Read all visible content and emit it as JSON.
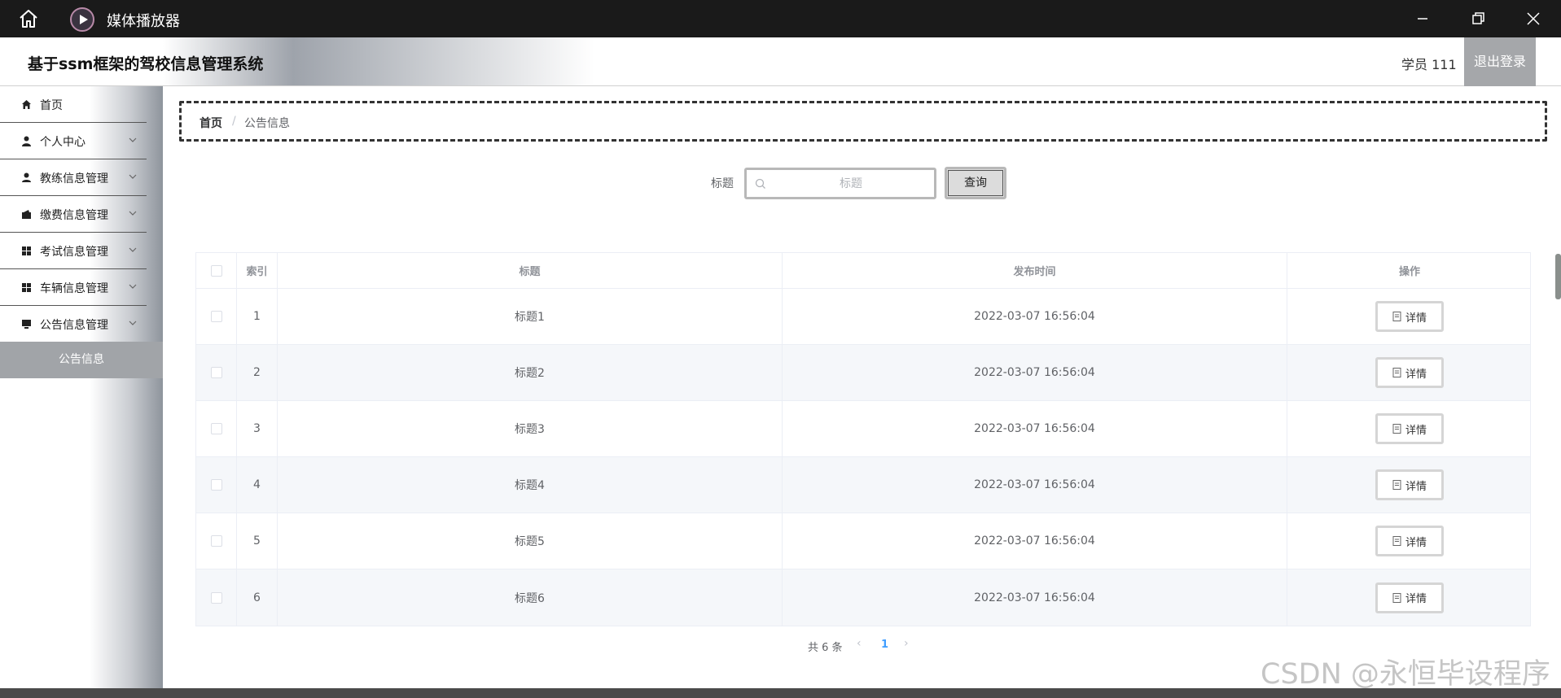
{
  "window": {
    "title": "媒体播放器",
    "icons": [
      "home-icon",
      "play-icon",
      "minimize-icon",
      "restore-icon",
      "close-icon"
    ]
  },
  "header": {
    "system_title": "基于ssm框架的驾校信息管理系统",
    "user_label": "学员 111",
    "logout_label": "退出登录"
  },
  "sidebar": {
    "items": [
      {
        "label": "首页",
        "icon": "home-icon"
      },
      {
        "label": "个人中心",
        "icon": "user-icon"
      },
      {
        "label": "教练信息管理",
        "icon": "user-icon"
      },
      {
        "label": "缴费信息管理",
        "icon": "wallet-icon"
      },
      {
        "label": "考试信息管理",
        "icon": "grid-icon"
      },
      {
        "label": "车辆信息管理",
        "icon": "grid-icon"
      },
      {
        "label": "公告信息管理",
        "icon": "monitor-icon"
      }
    ],
    "active_submenu": "公告信息"
  },
  "breadcrumb": {
    "home": "首页",
    "separator": "/",
    "current": "公告信息"
  },
  "search": {
    "label": "标题",
    "placeholder": "标题",
    "value": "",
    "button_label": "查询"
  },
  "table": {
    "columns": [
      "索引",
      "标题",
      "发布时间",
      "操作"
    ],
    "rows": [
      {
        "index": "1",
        "title": "标题1",
        "time": "2022-03-07 16:56:04",
        "action": "详情"
      },
      {
        "index": "2",
        "title": "标题2",
        "time": "2022-03-07 16:56:04",
        "action": "详情"
      },
      {
        "index": "3",
        "title": "标题3",
        "time": "2022-03-07 16:56:04",
        "action": "详情"
      },
      {
        "index": "4",
        "title": "标题4",
        "time": "2022-03-07 16:56:04",
        "action": "详情"
      },
      {
        "index": "5",
        "title": "标题5",
        "time": "2022-03-07 16:56:04",
        "action": "详情"
      },
      {
        "index": "6",
        "title": "标题6",
        "time": "2022-03-07 16:56:04",
        "action": "详情"
      }
    ]
  },
  "pagination": {
    "total_text": "共 6 条",
    "prev": "‹",
    "current_page": "1",
    "next": "›"
  },
  "watermark": "CSDN @永恒毕设程序",
  "colors": {
    "accent": "#409eff",
    "titlebar": "#1a1a1a",
    "logout_bg": "#a5a7aa",
    "active_menu_bg": "#a1a4a8"
  }
}
